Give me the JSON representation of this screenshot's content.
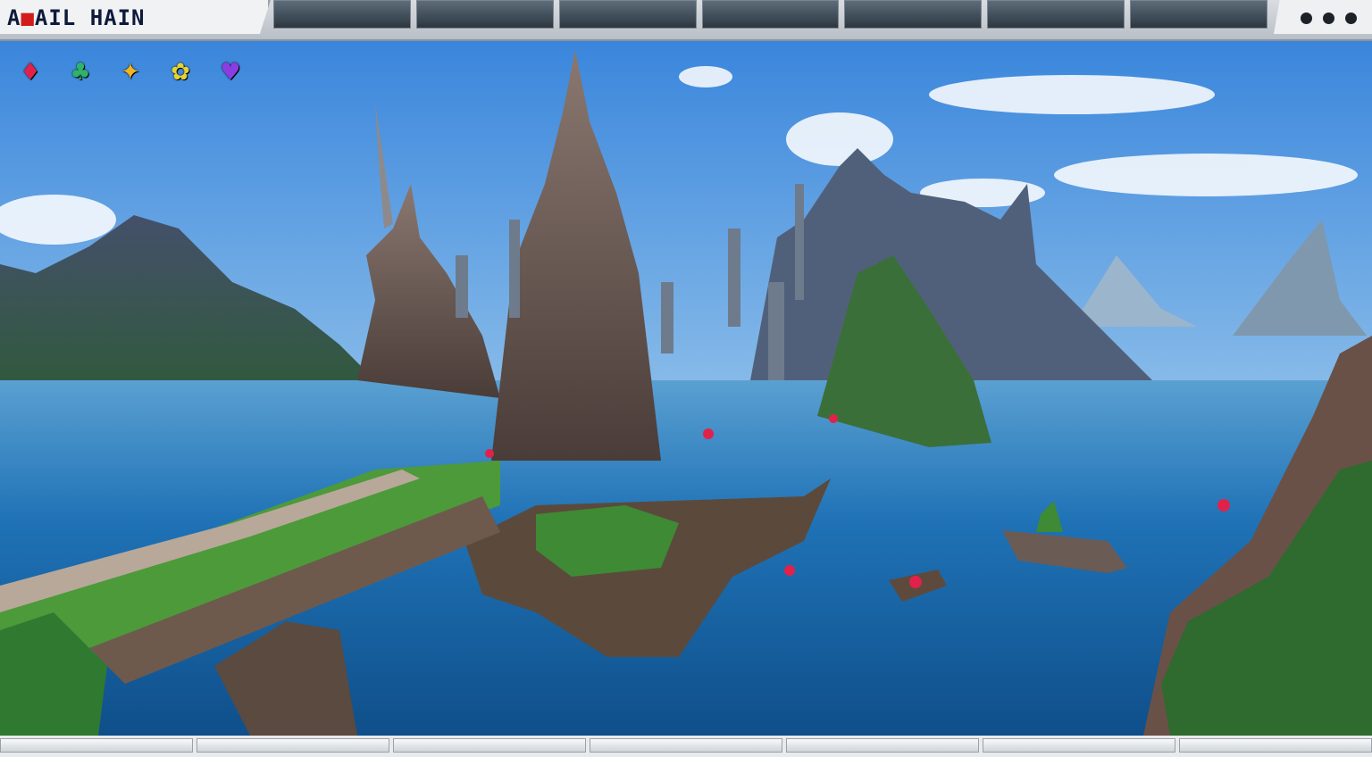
{
  "title": {
    "prefix": "A",
    "marker": "■",
    "main": "AIL HAIN"
  },
  "window_controls": [
    "●",
    "●",
    "●"
  ],
  "hud_items": [
    {
      "icon": "red-crystal-icon",
      "glyph": "♦",
      "color": "#e0224a"
    },
    {
      "icon": "green-gem-icon",
      "glyph": "♣",
      "color": "#2fb36a"
    },
    {
      "icon": "gold-shard-icon",
      "glyph": "✦",
      "color": "#f2b51e"
    },
    {
      "icon": "yellow-herb-icon",
      "glyph": "✿",
      "color": "#e8d230"
    },
    {
      "icon": "purple-gem-icon",
      "glyph": "♥",
      "color": "#8a3de0"
    }
  ],
  "scene": {
    "description_colors": {
      "sky_top": "#3f8fe0",
      "sky_horizon": "#bcd9ee",
      "water": "#1f6fb0",
      "stone": "#7a6a62",
      "grass": "#4d9a3a"
    }
  }
}
